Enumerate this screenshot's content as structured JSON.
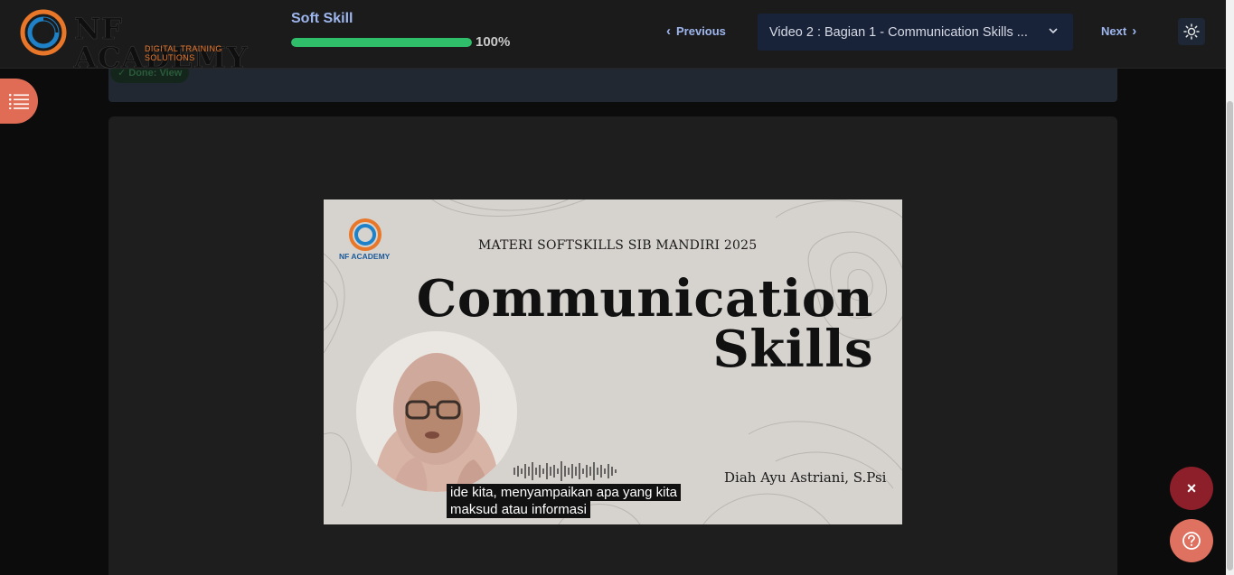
{
  "brand": {
    "name": "NF ACADEMY",
    "tagline": "DIGITAL TRAINING SOLUTIONS"
  },
  "course": {
    "title": "Soft Skill",
    "progress_percent": 100,
    "progress_label": "100%"
  },
  "nav": {
    "previous_label": "Previous",
    "next_label": "Next",
    "selected_video": "Video 2 : Bagian 1 - Communication Skills ..."
  },
  "status": {
    "done_label": "✓ Done: View"
  },
  "video": {
    "logo_text": "NF ACADEMY",
    "kicker": "MATERI SOFTSKILLS SIB MANDIRI 2025",
    "title_line1": "Communication",
    "title_line2": "Skills",
    "presenter": "Diah Ayu Astriani, S.Psi",
    "caption_line1": "ide kita, menyampaikan apa yang kita",
    "caption_line2": "maksud atau informasi"
  },
  "fab": {
    "close_symbol": "×",
    "help_icon": "question-circle-icon"
  },
  "colors": {
    "accent_blue": "#9eb6ee",
    "progress_green": "#2fbf6b",
    "menu_button": "#e06c55",
    "close_button": "#8d1f2b",
    "help_button": "#de7160"
  }
}
